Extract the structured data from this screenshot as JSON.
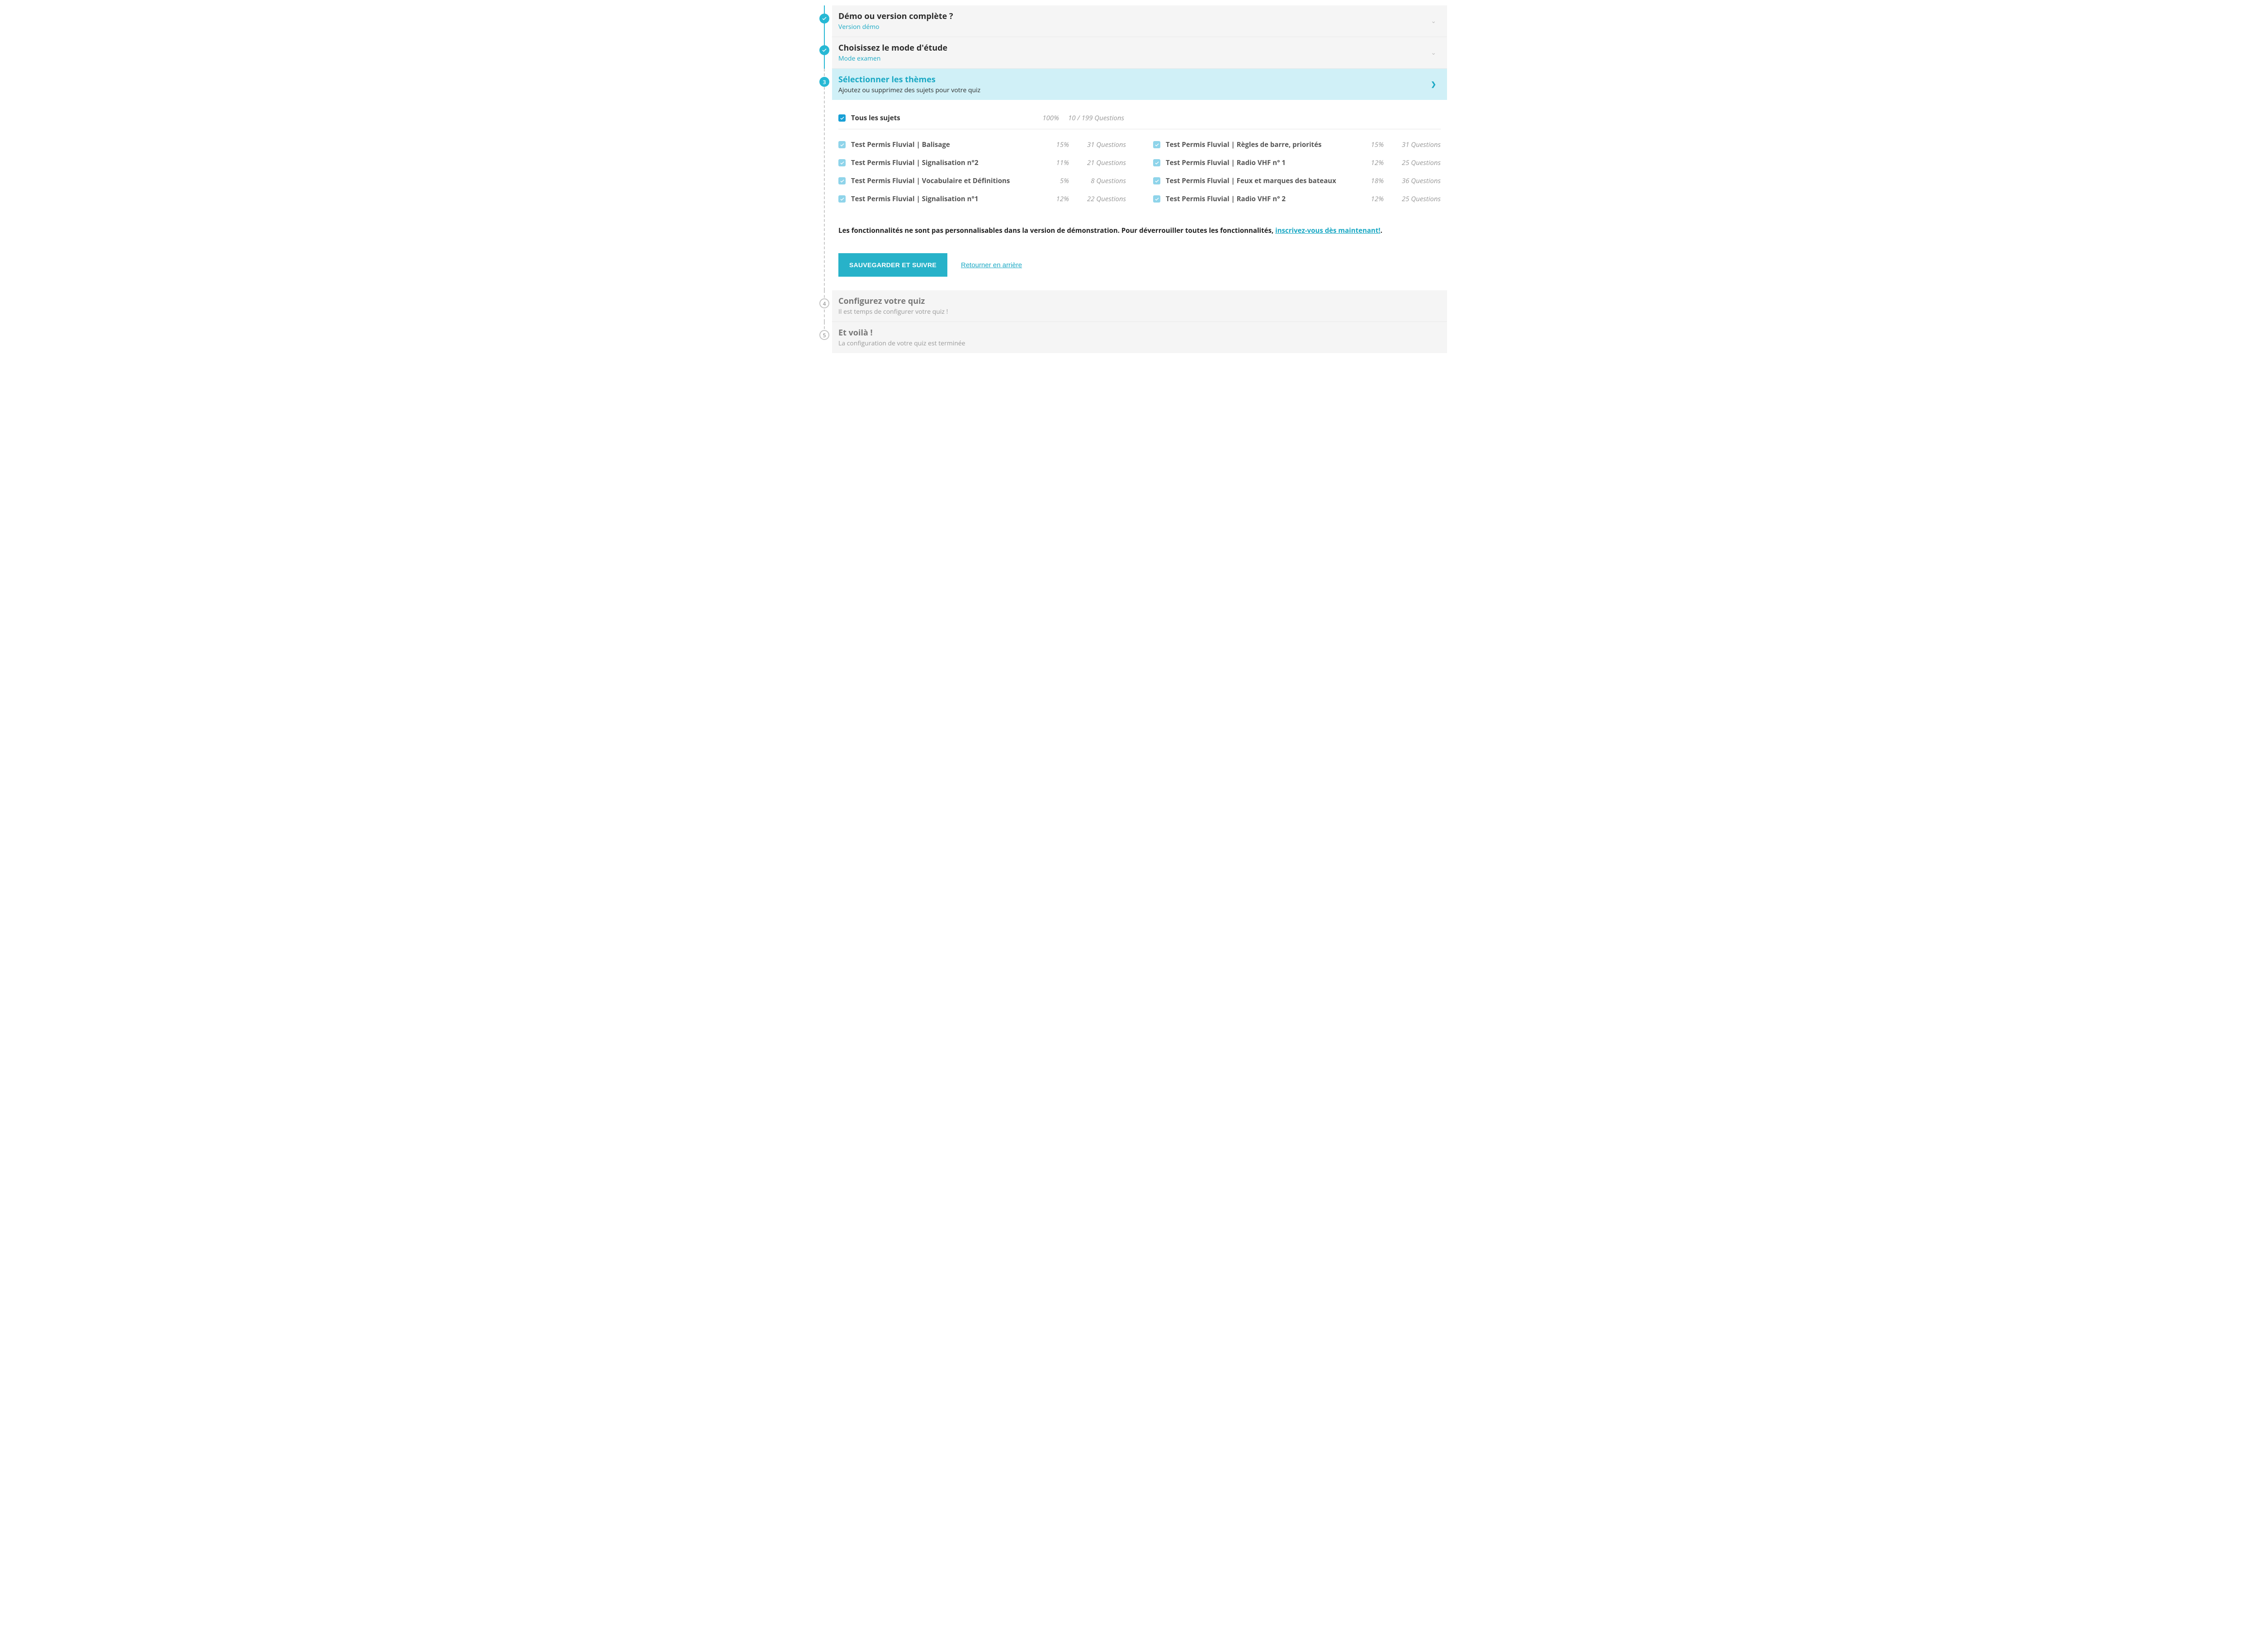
{
  "steps": {
    "s1": {
      "title": "Démo ou version complète ?",
      "sub": "Version démo"
    },
    "s2": {
      "title": "Choisissez le mode d'étude",
      "sub": "Mode examen"
    },
    "s3": {
      "title": "Sélectionner les thèmes",
      "sub": "Ajoutez ou supprimez des sujets pour votre quiz",
      "num": "3"
    },
    "s4": {
      "title": "Configurez votre quiz",
      "sub": "Il est temps de configurer votre quiz !",
      "num": "4"
    },
    "s5": {
      "title": "Et voilà !",
      "sub": "La configuration de votre quiz est terminée",
      "num": "5"
    }
  },
  "all": {
    "label": "Tous les sujets",
    "pct": "100%",
    "qcount": "10 / 199 Questions"
  },
  "topics_left": [
    {
      "label": "Test Permis Fluvial | Balisage",
      "pct": "15%",
      "qcount": "31 Questions"
    },
    {
      "label": "Test Permis Fluvial | Signalisation n°2",
      "pct": "11%",
      "qcount": "21 Questions"
    },
    {
      "label": "Test Permis Fluvial | Vocabulaire et Définitions",
      "pct": "5%",
      "qcount": "8 Questions"
    },
    {
      "label": "Test Permis Fluvial | Signalisation n°1",
      "pct": "12%",
      "qcount": "22 Questions"
    }
  ],
  "topics_right": [
    {
      "label": "Test Permis Fluvial | Règles de barre, priorités",
      "pct": "15%",
      "qcount": "31 Questions"
    },
    {
      "label": "Test Permis Fluvial | Radio VHF n° 1",
      "pct": "12%",
      "qcount": "25 Questions"
    },
    {
      "label": "Test Permis Fluvial | Feux et marques des bateaux",
      "pct": "18%",
      "qcount": "36 Questions"
    },
    {
      "label": "Test Permis Fluvial | Radio VHF n° 2",
      "pct": "12%",
      "qcount": "25 Questions"
    }
  ],
  "demo_note": {
    "prefix": "Les fonctionnalités ne sont pas personnalisables dans la version de démonstration. Pour déverrouiller toutes les fonctionnalités, ",
    "link": "inscrivez-vous dès maintenant!",
    "suffix": "."
  },
  "actions": {
    "save": "SAUVEGARDER ET SUIVRE",
    "back": "Retourner en arrière"
  }
}
